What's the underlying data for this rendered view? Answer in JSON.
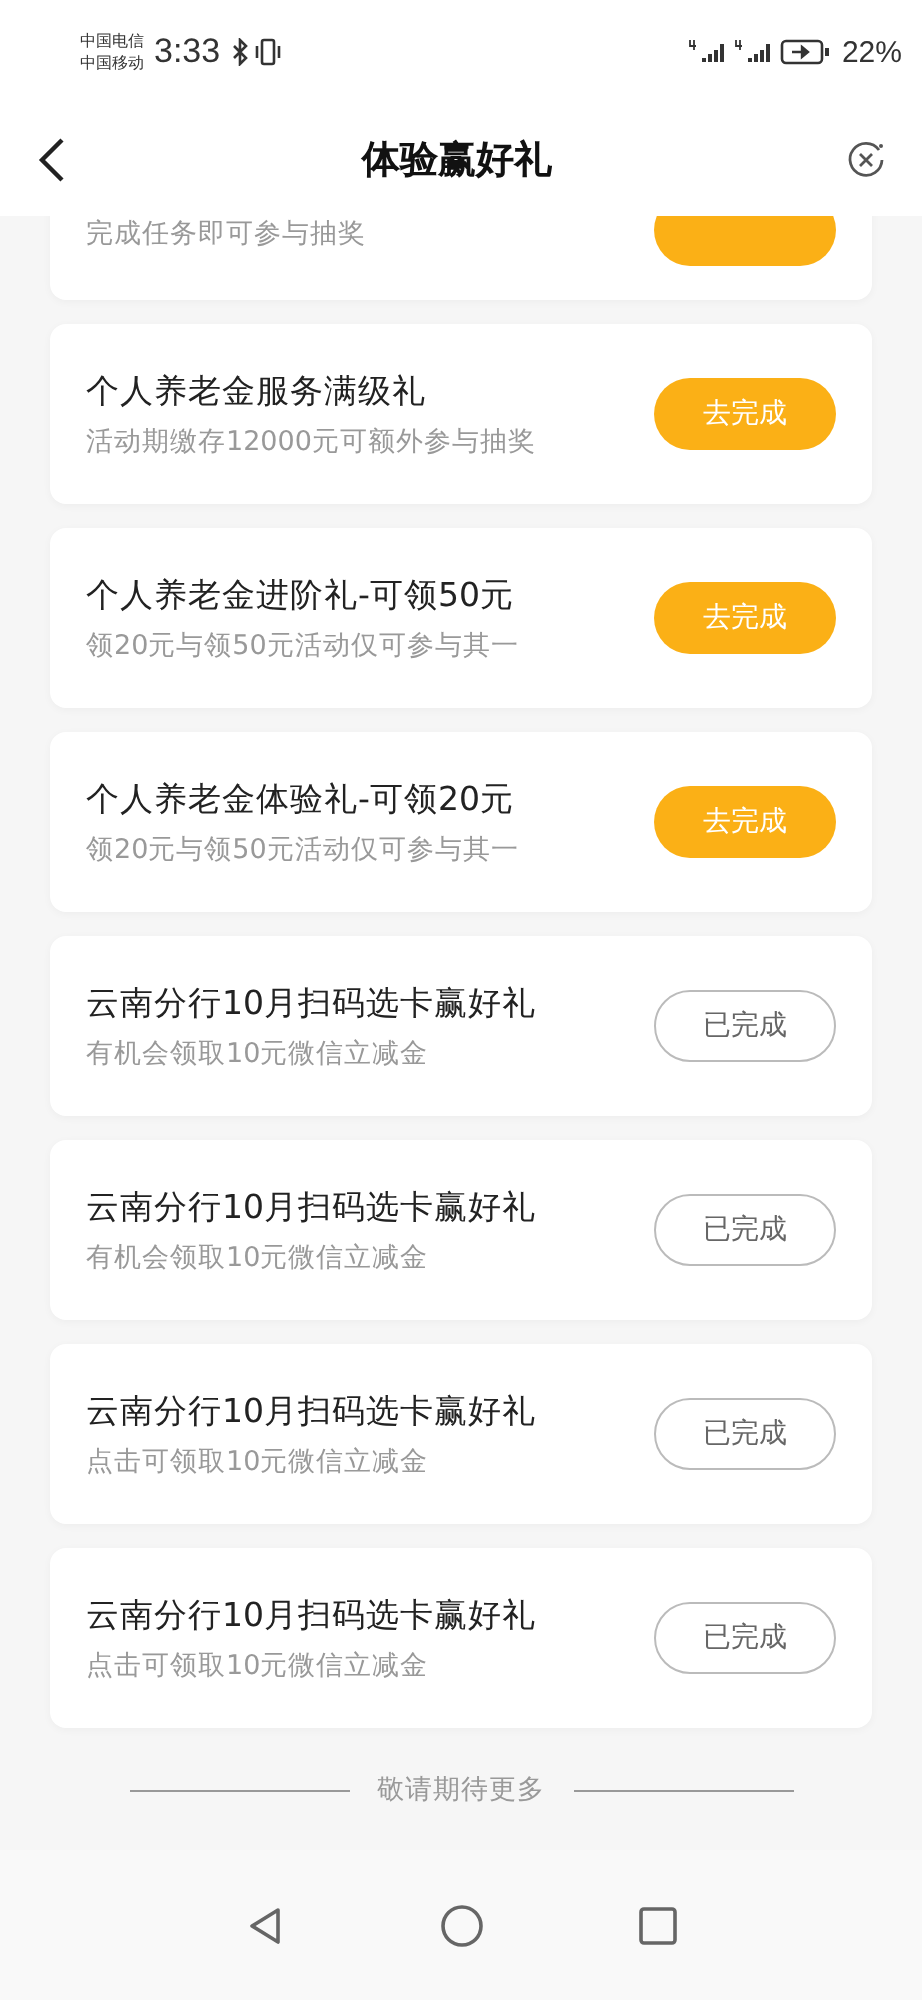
{
  "status_bar": {
    "carriers": [
      "中国电信",
      "中国移动"
    ],
    "time": "3:33",
    "battery": "22%"
  },
  "header": {
    "title": "体验赢好礼"
  },
  "tasks": [
    {
      "subtitle": "完成任务即可参与抽奖",
      "kind": "todo"
    },
    {
      "title": "个人养老金服务满级礼",
      "subtitle": "活动期缴存12000元可额外参与抽奖",
      "kind": "todo",
      "button": "去完成"
    },
    {
      "title": "个人养老金进阶礼-可领50元",
      "subtitle": "领20元与领50元活动仅可参与其一",
      "kind": "todo",
      "button": "去完成"
    },
    {
      "title": "个人养老金体验礼-可领20元",
      "subtitle": "领20元与领50元活动仅可参与其一",
      "kind": "todo",
      "button": "去完成"
    },
    {
      "title": "云南分行10月扫码选卡赢好礼",
      "subtitle": "有机会领取10元微信立减金",
      "kind": "done",
      "button": "已完成"
    },
    {
      "title": "云南分行10月扫码选卡赢好礼",
      "subtitle": "有机会领取10元微信立减金",
      "kind": "done",
      "button": "已完成"
    },
    {
      "title": "云南分行10月扫码选卡赢好礼",
      "subtitle": "点击可领取10元微信立减金",
      "kind": "done",
      "button": "已完成"
    },
    {
      "title": "云南分行10月扫码选卡赢好礼",
      "subtitle": "点击可领取10元微信立减金",
      "kind": "done",
      "button": "已完成"
    }
  ],
  "footer": {
    "text": "敬请期待更多"
  }
}
